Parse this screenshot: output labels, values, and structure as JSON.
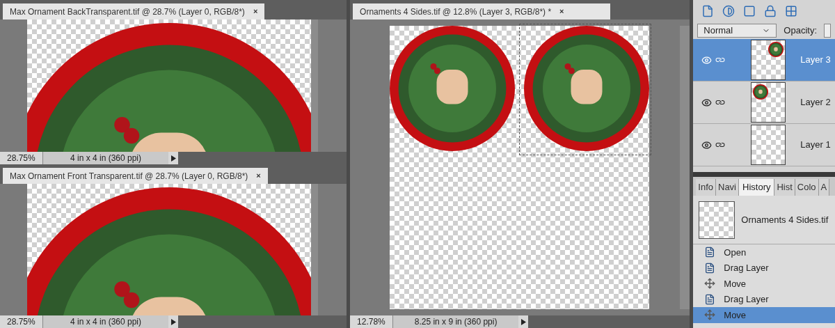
{
  "documents": [
    {
      "title": "Max Ornament BackTransparent.tif @ 28.7% (Layer 0, RGB/8*)",
      "close": "×",
      "zoom": "28.75%",
      "size": "4 in x 4 in (360 ppi)",
      "kind": "front"
    },
    {
      "title": "Max Ornament Front Transparent.tif @ 28.7% (Layer 0, RGB/8*)",
      "close": "×",
      "zoom": "28.75%",
      "size": "4 in x 4 in (360 ppi)",
      "kind": "front"
    },
    {
      "title": "Ornaments 4 Sides.tif @ 12.8% (Layer 3, RGB/8*) *",
      "close": "×",
      "zoom": "12.78%",
      "size": "8.25 in x 9 in (360 ppi)",
      "kind": "sheet"
    }
  ],
  "layers_panel": {
    "blend_mode": "Normal",
    "opacity_label": "Opacity:",
    "layers": [
      {
        "name": "Layer 3",
        "selected": true,
        "thumbnail": {
          "kind": "right"
        }
      },
      {
        "name": "Layer 2",
        "selected": false,
        "thumbnail": {
          "kind": "left"
        }
      },
      {
        "name": "Layer 1",
        "selected": false,
        "thumbnail": {
          "kind": "empty"
        }
      }
    ]
  },
  "history_panel": {
    "tabs": [
      {
        "label": "Info",
        "selected": false
      },
      {
        "label": "Navi",
        "selected": false
      },
      {
        "label": "History",
        "selected": true
      },
      {
        "label": "Hist",
        "selected": false
      },
      {
        "label": "Colo",
        "selected": false
      },
      {
        "label": "A",
        "selected": false
      }
    ],
    "snapshot": "Ornaments 4 Sides.tif",
    "items": [
      {
        "label": "Open",
        "kind": "document",
        "selected": false
      },
      {
        "label": "Drag Layer",
        "kind": "document",
        "selected": false
      },
      {
        "label": "Move",
        "kind": "move",
        "selected": false
      },
      {
        "label": "Drag Layer",
        "kind": "document",
        "selected": false
      },
      {
        "label": "Move",
        "kind": "move",
        "selected": true
      }
    ]
  }
}
